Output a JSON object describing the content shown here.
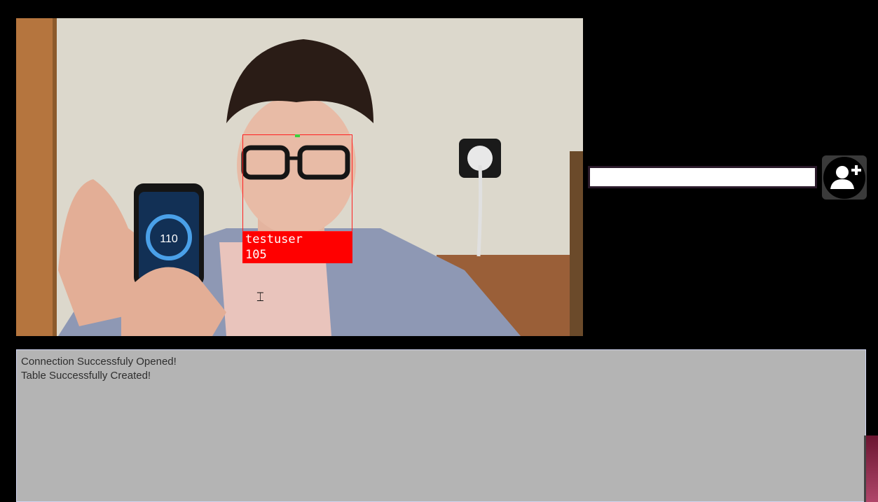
{
  "video": {
    "detection": {
      "name": "testuser",
      "value": "105"
    },
    "phone_reading": "110"
  },
  "sidebar": {
    "name_input": {
      "value": "",
      "placeholder": ""
    },
    "add_user_icon": "add-user-icon"
  },
  "console": {
    "lines": [
      "Connection Successfuly Opened!",
      "Table Successfully Created!"
    ]
  },
  "colors": {
    "face_box": "#ff0000",
    "console_bg": "#b4b4b4",
    "app_bg": "#000000"
  }
}
